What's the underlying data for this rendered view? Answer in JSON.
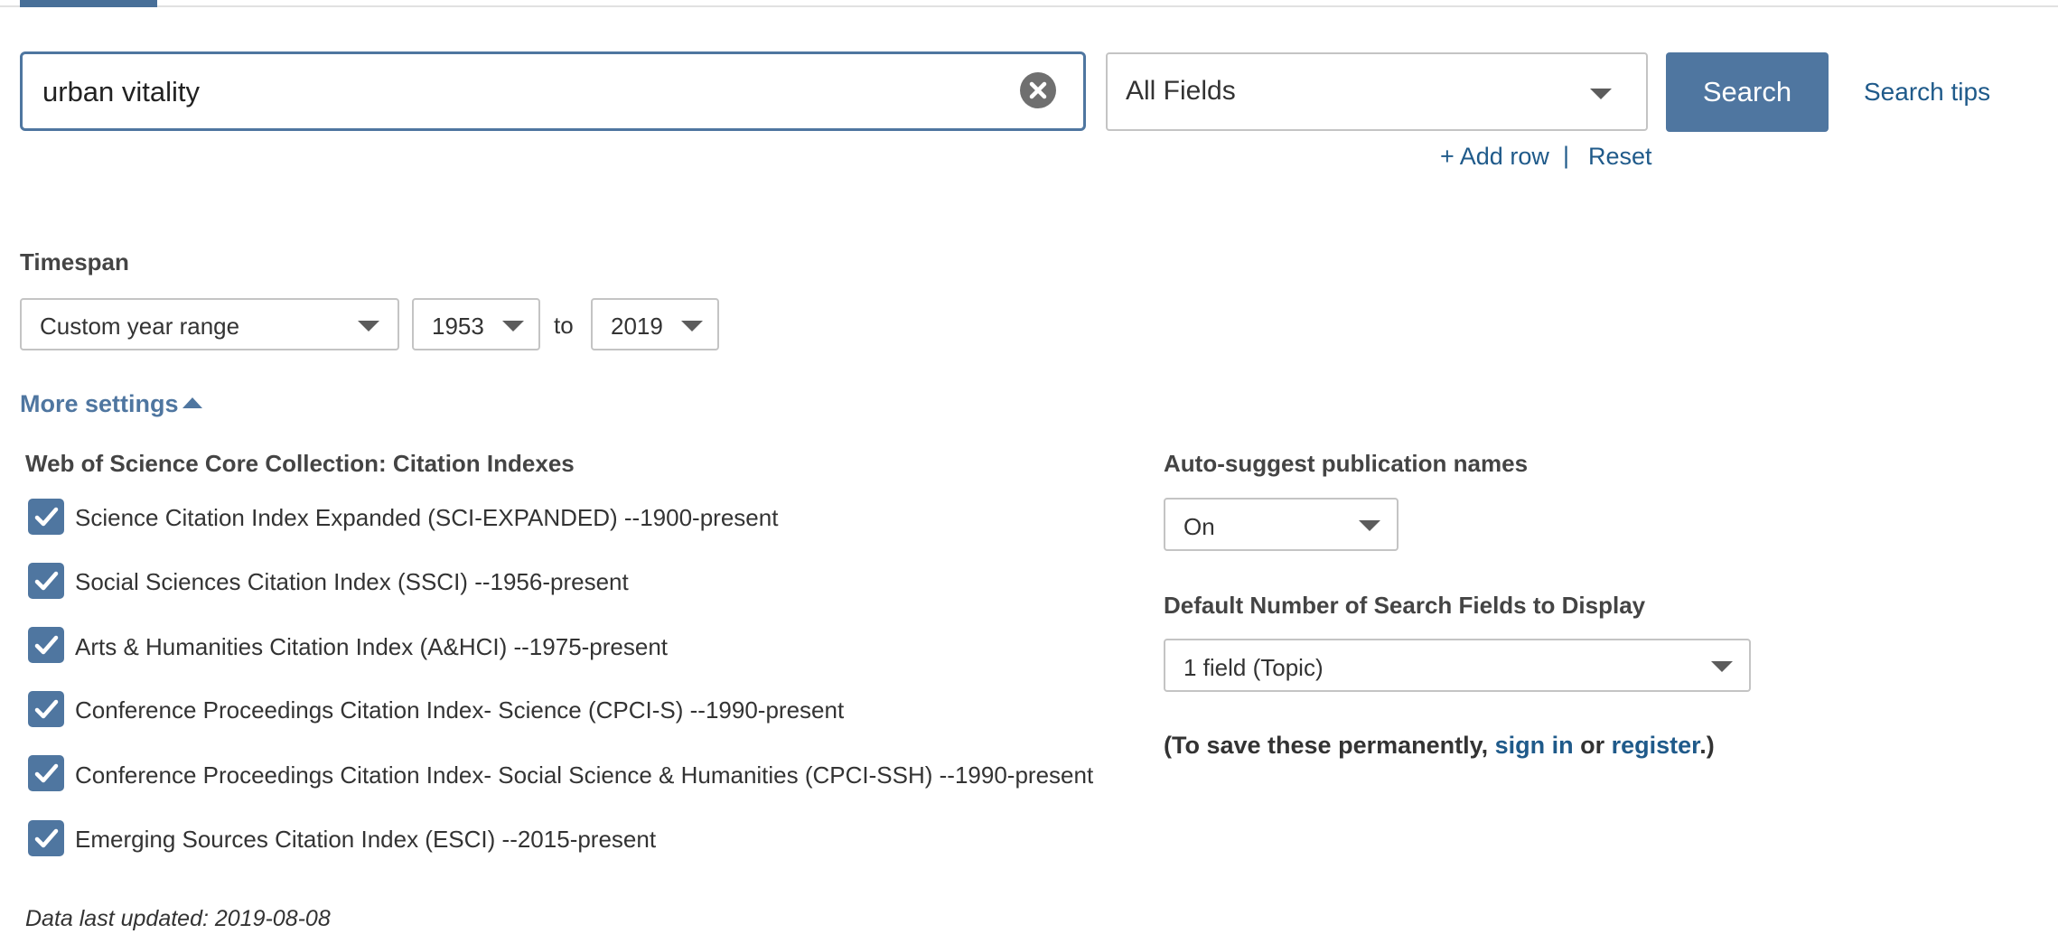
{
  "search": {
    "query": "urban vitality",
    "field": "All Fields",
    "button_label": "Search",
    "tips_label": "Search tips",
    "add_row_label": "+ Add row",
    "separator": "|",
    "reset_label": "Reset"
  },
  "timespan": {
    "label": "Timespan",
    "range_type": "Custom year range",
    "from_year": "1953",
    "to_label": "to",
    "to_year": "2019"
  },
  "more_settings": {
    "label": "More settings",
    "expanded": true
  },
  "citation_indexes": {
    "title": "Web of Science Core Collection: Citation Indexes",
    "items": [
      {
        "label": "Science Citation Index Expanded (SCI-EXPANDED) --1900-present",
        "checked": true
      },
      {
        "label": "Social Sciences Citation Index (SSCI) --1956-present",
        "checked": true
      },
      {
        "label": "Arts & Humanities Citation Index (A&HCI) --1975-present",
        "checked": true
      },
      {
        "label": "Conference Proceedings Citation Index- Science (CPCI-S) --1990-present",
        "checked": true
      },
      {
        "label": "Conference Proceedings Citation Index- Social Science & Humanities (CPCI-SSH) --1990-present",
        "checked": true
      },
      {
        "label": "Emerging Sources Citation Index (ESCI) --2015-present",
        "checked": true
      }
    ]
  },
  "auto_suggest": {
    "title": "Auto-suggest publication names",
    "value": "On"
  },
  "default_fields": {
    "title": "Default Number of Search Fields to Display",
    "value": "1 field (Topic)"
  },
  "save_note": {
    "prefix": "(To save these permanently, ",
    "sign_in": "sign in",
    "middle": " or ",
    "register": "register",
    "suffix": ".)"
  },
  "data_updated": "Data last updated: 2019-08-08",
  "colors": {
    "accent": "#4f76a0",
    "link": "#1f5a8a"
  }
}
